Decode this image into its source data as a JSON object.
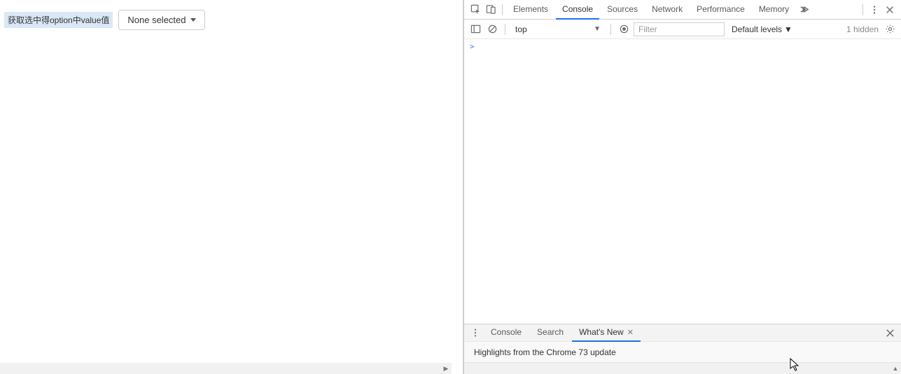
{
  "page": {
    "button_label": "获取选中得option中value值",
    "dropdown_label": "None selected"
  },
  "devtools": {
    "tabs": [
      "Elements",
      "Console",
      "Sources",
      "Network",
      "Performance",
      "Memory"
    ],
    "active_tab": "Console",
    "console_toolbar": {
      "context": "top",
      "filter_placeholder": "Filter",
      "levels_label": "Default levels",
      "hidden_label": "1 hidden"
    },
    "prompt": ">",
    "drawer": {
      "tabs": [
        "Console",
        "Search",
        "What's New"
      ],
      "active_tab": "What's New",
      "headline": "Highlights from the Chrome 73 update"
    }
  }
}
